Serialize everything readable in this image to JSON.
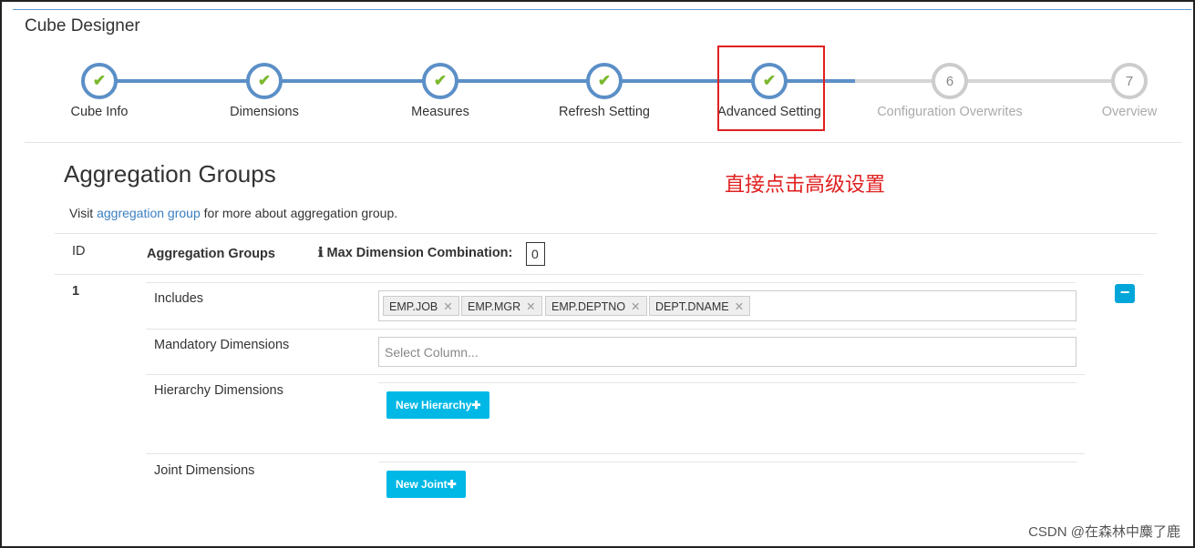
{
  "header": {
    "title": "Cube Designer"
  },
  "stepper": {
    "steps": [
      {
        "label": "Cube Info",
        "state": "done"
      },
      {
        "label": "Dimensions",
        "state": "done"
      },
      {
        "label": "Measures",
        "state": "done"
      },
      {
        "label": "Refresh Setting",
        "state": "done"
      },
      {
        "label": "Advanced Setting",
        "state": "done"
      },
      {
        "label": "Configuration Overwrites",
        "number": "6",
        "state": "todo"
      },
      {
        "label": "Overview",
        "number": "7",
        "state": "todo"
      }
    ]
  },
  "annotation": "直接点击高级设置",
  "section": {
    "title": "Aggregation Groups",
    "visit_prefix": "Visit ",
    "visit_link": "aggregation group",
    "visit_suffix": " for more about aggregation group."
  },
  "table": {
    "col_id": "ID",
    "col_groups": "Aggregation Groups",
    "max_label": "Max Dimension Combination:",
    "max_value": "0"
  },
  "group": {
    "id": "1",
    "includes_label": "Includes",
    "includes": [
      "EMP.JOB",
      "EMP.MGR",
      "EMP.DEPTNO",
      "DEPT.DNAME"
    ],
    "mandatory_label": "Mandatory Dimensions",
    "mandatory_placeholder": "Select Column...",
    "hierarchy_label": "Hierarchy Dimensions",
    "new_hierarchy": "New Hierarchy",
    "joint_label": "Joint Dimensions",
    "new_joint": "New Joint"
  },
  "watermark": "CSDN @在森林中麋了鹿",
  "colors": {
    "accent": "#5b8fc7",
    "check": "#7cb82f",
    "button": "#00b8e6",
    "annotation": "#e02020"
  }
}
